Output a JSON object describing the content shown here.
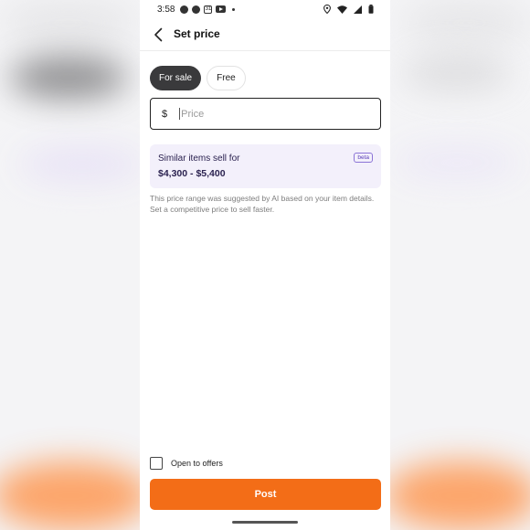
{
  "status_bar": {
    "time": "3:58",
    "icons": [
      "messenger-icon",
      "chat-bubble-icon",
      "calendar-icon",
      "youtube-icon",
      "notification-dot-icon",
      "location-icon",
      "wifi-icon",
      "signal-icon",
      "battery-icon"
    ],
    "calendar_day": "31"
  },
  "header": {
    "title": "Set price",
    "back_icon": "chevron-left-icon"
  },
  "listing_type": {
    "options": [
      {
        "label": "For sale",
        "selected": true
      },
      {
        "label": "Free",
        "selected": false
      }
    ]
  },
  "price_input": {
    "currency_symbol": "$",
    "placeholder": "Price",
    "value": ""
  },
  "suggestion": {
    "label": "Similar items sell for",
    "range": "$4,300 - $5,400",
    "badge": "beta",
    "helper_text": "This price range was suggested by AI based on your item details. Set a competitive price to sell faster."
  },
  "offers": {
    "label": "Open to offers",
    "checked": false
  },
  "actions": {
    "post_label": "Post"
  },
  "colors": {
    "accent": "#f36d17",
    "chip_active": "#3a3a3c",
    "suggestion_bg": "#f3f0fb",
    "suggestion_text": "#2b2250"
  }
}
